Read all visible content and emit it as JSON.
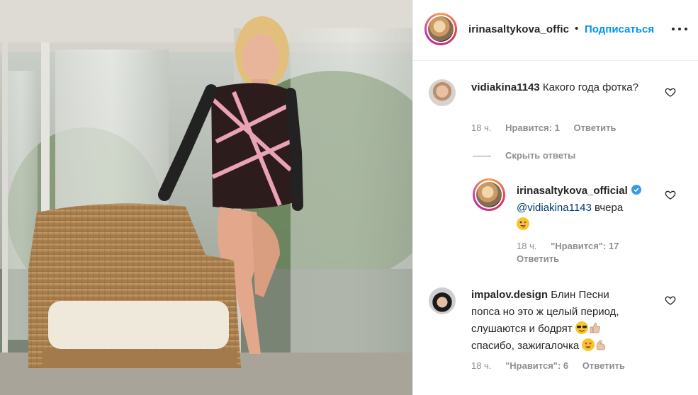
{
  "post": {
    "owner": "irinasaltykova_offic",
    "separator": "•",
    "follow_label": "Подписаться"
  },
  "comments": [
    {
      "user": "vidiakina1143",
      "text": "Какого года фотка?",
      "time": "18 ч.",
      "likes": "Нравится: 1",
      "reply_label": "Ответить"
    }
  ],
  "replies_toggle": "Скрыть ответы",
  "reply": {
    "user": "irinasaltykova_official",
    "mention": "@vidiakina1143",
    "text": "вчера",
    "time": "18 ч.",
    "likes": "\"Нравится\": 17",
    "reply_label": "Ответить"
  },
  "comment2": {
    "user": "impalov.design",
    "text_line1": "Блин Песни",
    "text_line2": "попса но это ж целый период,",
    "text_line3": "слушаются и бодрят",
    "text_line4": "спасибо, зажигалочка",
    "time": "18 ч.",
    "likes": "\"Нравится\": 6",
    "reply_label": "Ответить"
  },
  "icons": {
    "more": "more-options-icon",
    "heart": "heart-outline-icon",
    "verified": "verified-badge-icon"
  },
  "colors": {
    "link_blue": "#0095f6",
    "mention": "#00376b",
    "muted": "#8e8e8e",
    "verified": "#3897f0"
  }
}
